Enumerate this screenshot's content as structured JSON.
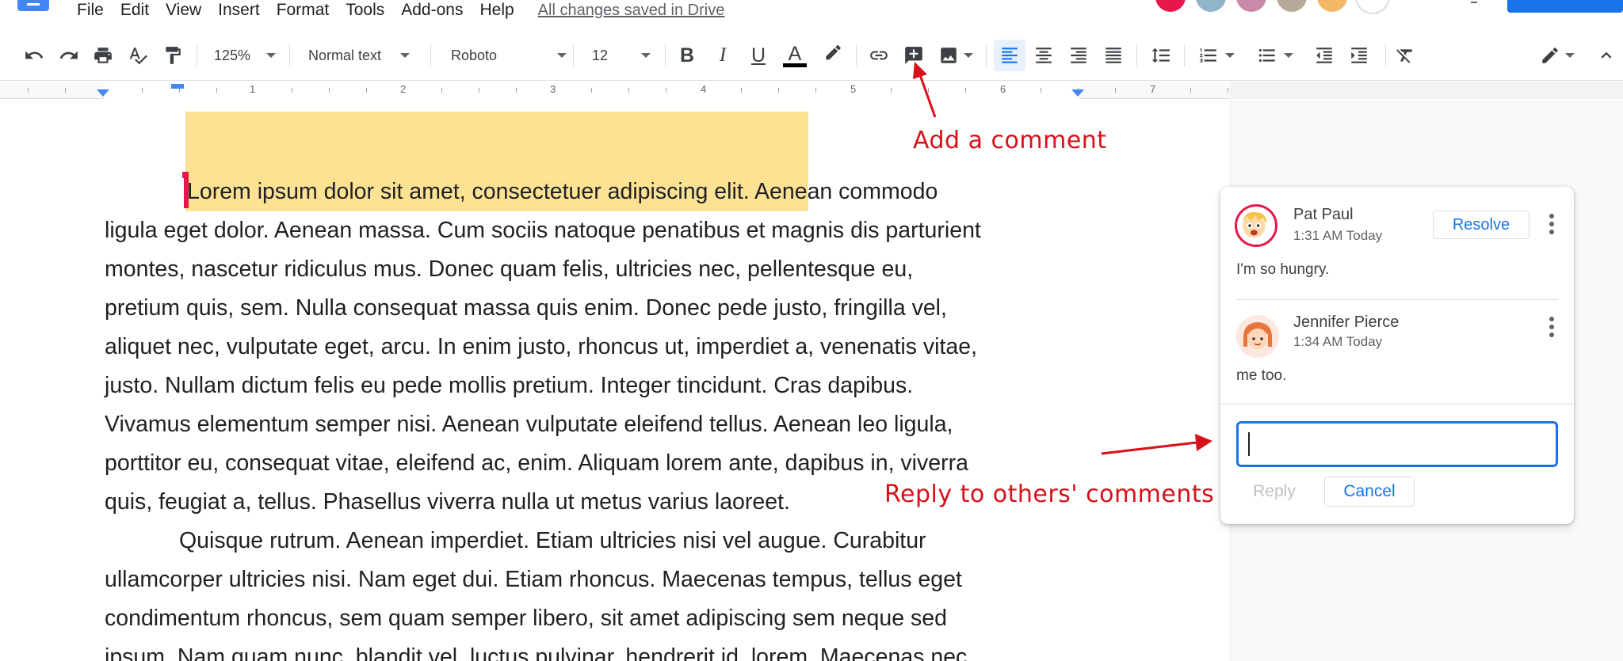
{
  "menu": {
    "items": [
      "File",
      "Edit",
      "View",
      "Insert",
      "Format",
      "Tools",
      "Add-ons",
      "Help"
    ],
    "save_status": "All changes saved in Drive"
  },
  "toolbar": {
    "zoom": "125%",
    "style": "Normal text",
    "font": "Roboto",
    "font_size": "12",
    "bold": "B",
    "italic": "I",
    "underline": "U",
    "text_color": "A"
  },
  "ruler": {
    "numbers": [
      "1",
      "2",
      "3",
      "4",
      "5",
      "6",
      "7"
    ]
  },
  "document": {
    "lines": [
      "Lorem ipsum dolor sit amet, consectetuer adipiscing elit. Aenean commodo",
      "ligula eget dolor. Aenean massa. Cum sociis natoque penatibus et magnis dis parturient",
      "montes, nascetur ridiculus mus. Donec quam felis, ultricies nec, pellentesque eu,",
      "pretium quis, sem. Nulla consequat massa quis enim. Donec pede justo, fringilla vel,",
      "aliquet nec, vulputate eget, arcu. In enim justo, rhoncus ut, imperdiet a, venenatis vitae,",
      "justo. Nullam dictum felis eu pede mollis pretium. Integer tincidunt. Cras dapibus.",
      "Vivamus elementum semper nisi. Aenean vulputate eleifend tellus. Aenean leo ligula,",
      "porttitor eu, consequat vitae, eleifend ac, enim. Aliquam lorem ante, dapibus in, viverra",
      "quis, feugiat a, tellus. Phasellus viverra nulla ut metus varius laoreet.",
      "Quisque rutrum. Aenean imperdiet. Etiam ultricies nisi vel augue. Curabitur",
      "ullamcorper ultricies nisi. Nam eget dui. Etiam rhoncus. Maecenas tempus, tellus eget",
      "condimentum rhoncus, sem quam semper libero, sit amet adipiscing sem neque sed",
      "ipsum. Nam quam nunc, blandit vel, luctus pulvinar, hendrerit id, lorem. Maecenas nec"
    ]
  },
  "annotations": {
    "add_comment": "Add a comment",
    "reply": "Reply to others' comments"
  },
  "comments": [
    {
      "author": "Pat Paul",
      "time": "1:31 AM Today",
      "text": "I'm so hungry."
    },
    {
      "author": "Jennifer Pierce",
      "time": "1:34 AM Today",
      "text": "me too."
    }
  ],
  "comment_actions": {
    "resolve": "Resolve",
    "reply": "Reply",
    "cancel": "Cancel",
    "reply_placeholder": ""
  },
  "colors": {
    "accent": "#1a73e8",
    "highlight": "#fde293",
    "annotation": "#d8101a"
  }
}
